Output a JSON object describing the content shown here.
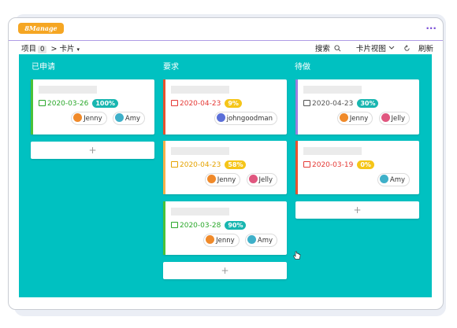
{
  "app": {
    "logo": "8Manage",
    "more": "..."
  },
  "toolbar": {
    "project_label": "项目",
    "project_count": "0",
    "breadcrumb_sep": ">",
    "card_label": "卡片",
    "search": "搜索",
    "view": "卡片视图",
    "refresh": "刷新"
  },
  "columns": [
    {
      "title": "已申请",
      "cards": [
        {
          "date": "2020-03-26",
          "percent": "100%",
          "accent": "#49c238",
          "date_color": "#2aa82a",
          "pct_color": "#18b6b0",
          "users": [
            {
              "name": "Jenny",
              "avatar": "#f08a2a"
            },
            {
              "name": "Amy",
              "avatar": "#3fb0c9"
            }
          ]
        }
      ],
      "add": "+"
    },
    {
      "title": "要求",
      "cards": [
        {
          "date": "2020-04-23",
          "percent": "9%",
          "accent": "#e8522e",
          "date_color": "#e53935",
          "pct_color": "#f5c518",
          "users": [
            {
              "name": "johngoodman",
              "avatar": "#5b6fd8"
            }
          ]
        },
        {
          "date": "2020-04-23",
          "percent": "58%",
          "accent": "#f6b14a",
          "date_color": "#e5a300",
          "pct_color": "#f5c518",
          "users": [
            {
              "name": "Jenny",
              "avatar": "#f08a2a"
            },
            {
              "name": "Jelly",
              "avatar": "#e0577f"
            }
          ]
        },
        {
          "date": "2020-03-28",
          "percent": "90%",
          "accent": "#49c238",
          "date_color": "#2aa82a",
          "pct_color": "#18b6b0",
          "users": [
            {
              "name": "Jenny",
              "avatar": "#f08a2a"
            },
            {
              "name": "Amy",
              "avatar": "#3fb0c9"
            }
          ]
        }
      ],
      "add": "+"
    },
    {
      "title": "待做",
      "cards": [
        {
          "date": "2020-04-23",
          "percent": "30%",
          "accent": "#9b7fe0",
          "date_color": "#555555",
          "pct_color": "#18b6b0",
          "users": [
            {
              "name": "Jenny",
              "avatar": "#f08a2a"
            },
            {
              "name": "Jelly",
              "avatar": "#e0577f"
            }
          ]
        },
        {
          "date": "2020-03-19",
          "percent": "0%",
          "accent": "#e8522e",
          "date_color": "#e53935",
          "pct_color": "#f5c518",
          "users": [
            {
              "name": "Amy",
              "avatar": "#3fb0c9"
            }
          ]
        }
      ],
      "add": "+"
    }
  ]
}
